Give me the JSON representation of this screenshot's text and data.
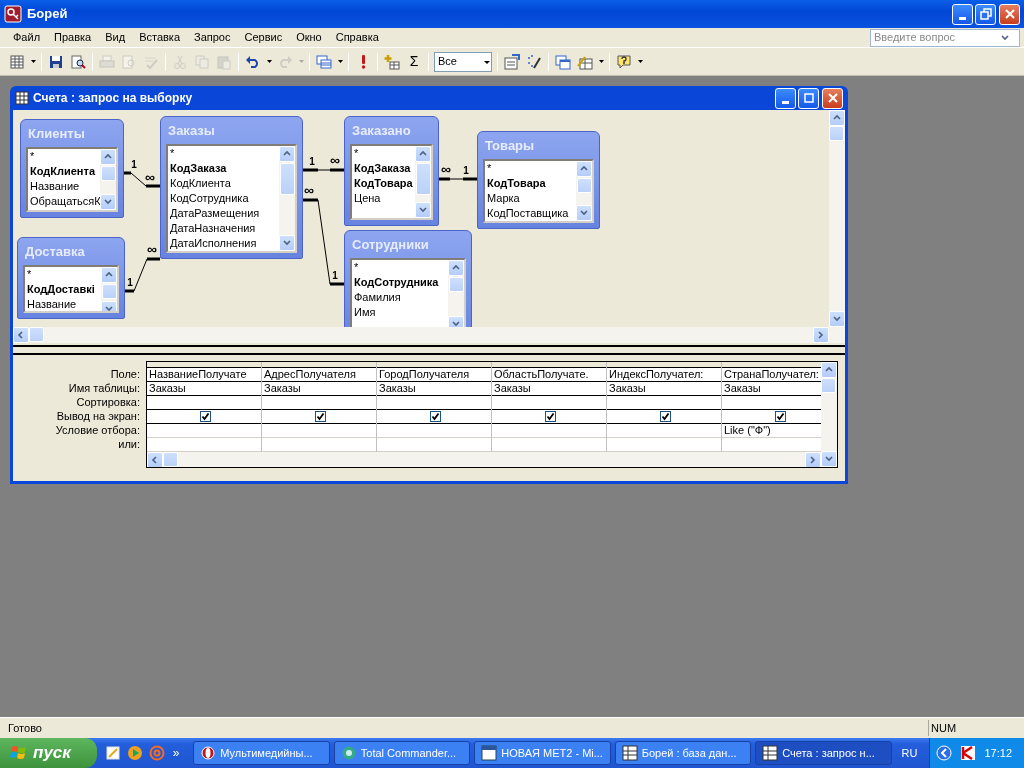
{
  "app": {
    "title": "Борей"
  },
  "menu": [
    {
      "label": "Файл"
    },
    {
      "label": "Правка"
    },
    {
      "label": "Вид"
    },
    {
      "label": "Вставка"
    },
    {
      "label": "Запрос"
    },
    {
      "label": "Сервис"
    },
    {
      "label": "Окно"
    },
    {
      "label": "Справка"
    }
  ],
  "search": {
    "placeholder": "Введите вопрос"
  },
  "toolbar": [
    {
      "kind": "button",
      "disabled": false
    },
    {
      "kind": "caret",
      "disabled": false
    },
    {
      "kind": "separator"
    },
    {
      "kind": "button",
      "disabled": false
    },
    {
      "kind": "button",
      "disabled": false
    },
    {
      "kind": "separator"
    },
    {
      "kind": "button",
      "disabled": true
    },
    {
      "kind": "button",
      "disabled": true
    },
    {
      "kind": "button",
      "disabled": true
    },
    {
      "kind": "separator"
    },
    {
      "kind": "button",
      "disabled": true
    },
    {
      "kind": "button",
      "disabled": true
    },
    {
      "kind": "button",
      "disabled": true
    },
    {
      "kind": "separator"
    },
    {
      "kind": "button",
      "disabled": false
    },
    {
      "kind": "caret",
      "disabled": false
    },
    {
      "kind": "button",
      "disabled": true
    },
    {
      "kind": "caret",
      "disabled": true
    },
    {
      "kind": "separator"
    },
    {
      "kind": "button",
      "disabled": false
    },
    {
      "kind": "caret",
      "disabled": false
    },
    {
      "kind": "separator"
    },
    {
      "kind": "button",
      "disabled": false
    },
    {
      "kind": "separator"
    },
    {
      "kind": "button",
      "disabled": false
    },
    {
      "kind": "glyph",
      "label": "Σ",
      "disabled": false
    },
    {
      "kind": "separator"
    },
    {
      "kind": "combo",
      "value": "Все"
    },
    {
      "kind": "separator"
    },
    {
      "kind": "button",
      "disabled": false
    },
    {
      "kind": "button",
      "disabled": false
    },
    {
      "kind": "separator"
    },
    {
      "kind": "button",
      "disabled": false
    },
    {
      "kind": "button",
      "disabled": false
    },
    {
      "kind": "caret",
      "disabled": false
    },
    {
      "kind": "separator"
    },
    {
      "kind": "button",
      "disabled": false
    },
    {
      "kind": "caret",
      "disabled": false
    }
  ],
  "query_window": {
    "title": "Счета : запрос на выборку",
    "tables": [
      {
        "name": "Клиенты",
        "fields": [
          {
            "label": "*",
            "key": false
          },
          {
            "label": "КодКлиента",
            "key": true
          },
          {
            "label": "Название",
            "key": false
          },
          {
            "label": "ОбращатьсяК",
            "key": false
          }
        ]
      },
      {
        "name": "Заказы",
        "fields": [
          {
            "label": "*",
            "key": false
          },
          {
            "label": "КодЗаказа",
            "key": true
          },
          {
            "label": "КодКлиента",
            "key": false
          },
          {
            "label": "КодСотрудника",
            "key": false
          },
          {
            "label": "ДатаРазмещения",
            "key": false
          },
          {
            "label": "ДатаНазначения",
            "key": false
          },
          {
            "label": "ДатаИсполнения",
            "key": false
          }
        ]
      },
      {
        "name": "Заказано",
        "fields": [
          {
            "label": "*",
            "key": false
          },
          {
            "label": "КодЗаказа",
            "key": true
          },
          {
            "label": "КодТовара",
            "key": true
          },
          {
            "label": "Цена",
            "key": false
          }
        ]
      },
      {
        "name": "Товары",
        "fields": [
          {
            "label": "*",
            "key": false
          },
          {
            "label": "КодТовара",
            "key": true
          },
          {
            "label": "Марка",
            "key": false
          },
          {
            "label": "КодПоставщика",
            "key": false
          }
        ]
      },
      {
        "name": "Доставка",
        "fields": [
          {
            "label": "*",
            "key": false
          },
          {
            "label": "КодДоставкі",
            "key": true
          },
          {
            "label": "Название",
            "key": false
          }
        ]
      },
      {
        "name": "Сотрудники",
        "fields": [
          {
            "label": "*",
            "key": false
          },
          {
            "label": "КодСотрудника",
            "key": true
          },
          {
            "label": "Фамилия",
            "key": false
          },
          {
            "label": "Имя",
            "key": false
          }
        ]
      }
    ],
    "relations": [
      {
        "one": "1",
        "many": "∞"
      },
      {
        "one": "1",
        "many": "∞"
      },
      {
        "one": "1",
        "many": "∞"
      },
      {
        "one": "1",
        "many": "∞"
      },
      {
        "one": "1",
        "many": "∞"
      }
    ],
    "row_labels": [
      "Поле:",
      "Имя таблицы:",
      "Сортировка:",
      "Вывод на экран:",
      "Условие отбора:",
      "или:"
    ],
    "columns": [
      {
        "field": "НазваниеПолучате",
        "table": "Заказы",
        "show": true
      },
      {
        "field": "АдресПолучателя",
        "table": "Заказы",
        "show": true
      },
      {
        "field": "ГородПолучателя",
        "table": "Заказы",
        "show": true
      },
      {
        "field": "ОбластьПолучате.",
        "table": "Заказы",
        "show": true
      },
      {
        "field": "ИндексПолучател:",
        "table": "Заказы",
        "show": true
      },
      {
        "field": "СтранаПолучател:",
        "table": "Заказы",
        "show": true,
        "criteria": "Like (\"Ф\")"
      }
    ]
  },
  "status_bar": {
    "text": "Готово",
    "indicator": "NUM"
  },
  "taskbar": {
    "start": "пуск",
    "more": "»",
    "tasks": [
      {
        "label": "Мультимедийны...",
        "selected": false
      },
      {
        "label": "Total Commander...",
        "selected": false
      },
      {
        "label": "НОВАЯ МЕТ2 - Mi...",
        "selected": false
      },
      {
        "label": "Борей : база дан...",
        "selected": false
      },
      {
        "label": "Счета : запрос н...",
        "selected": true
      }
    ],
    "language": "RU",
    "clock": "17:12"
  }
}
